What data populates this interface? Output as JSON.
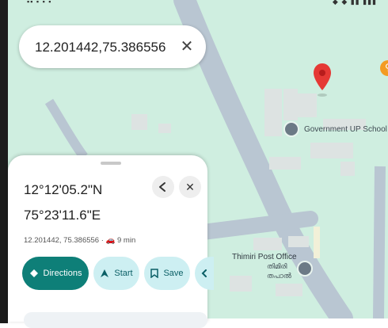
{
  "search": {
    "text": "12.201442,75.386556",
    "clear_symbol": "✕"
  },
  "map": {
    "labels": {
      "school": "Government UP School",
      "post_office_1": "Thimiri Post Office",
      "post_office_2": "തിമിരി",
      "post_office_3": "തപാൽ"
    },
    "icons": {
      "pin_color": "#e53935",
      "orange_marker_color": "#f39b22"
    }
  },
  "sheet": {
    "title_lat": "12°12'05.2\"N",
    "title_lon": "75°23'11.6\"E",
    "subtitle": "12.201442, 75.386556 · 🚗 9 min",
    "buttons": {
      "directions": "Directions",
      "start": "Start",
      "save": "Save"
    },
    "icons": {
      "share": "share-icon",
      "close": "close-icon"
    }
  }
}
